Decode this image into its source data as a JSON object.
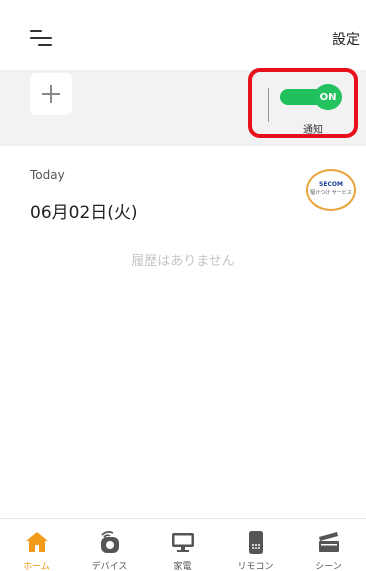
{
  "header": {
    "settings_label": "設定"
  },
  "notifications": {
    "toggle_state": "ON",
    "label": "通知",
    "toggle_color": "#22c25e",
    "highlight_color": "#e8101c"
  },
  "history": {
    "today_label": "Today",
    "date": "06月02日(火)",
    "empty_message": "履歴はありません"
  },
  "badge": {
    "brand": "SECOM",
    "subtext": "駆けつけ サービス"
  },
  "nav": {
    "items": [
      {
        "label": "ホーム",
        "icon": "home-icon",
        "active": true
      },
      {
        "label": "デバイス",
        "icon": "device-icon",
        "active": false
      },
      {
        "label": "家電",
        "icon": "monitor-icon",
        "active": false
      },
      {
        "label": "リモコン",
        "icon": "remote-icon",
        "active": false
      },
      {
        "label": "シーン",
        "icon": "clapper-icon",
        "active": false
      }
    ],
    "active_color": "#f39a1a"
  }
}
